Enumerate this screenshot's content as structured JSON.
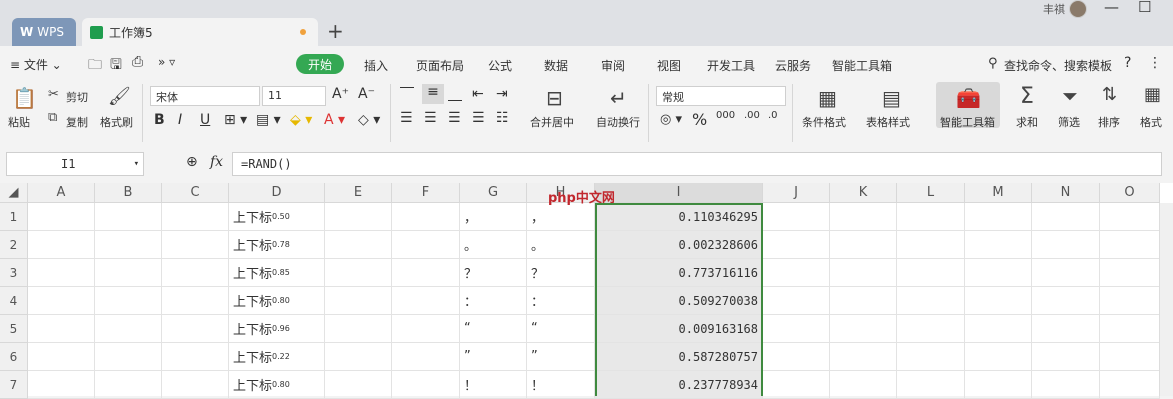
{
  "tabs": {
    "wps": "WPS",
    "workbook": "工作簿5",
    "add": "+"
  },
  "user": {
    "name": "丰祺"
  },
  "window": {
    "minimize": "—",
    "maximize": "☐"
  },
  "menu": {
    "file": "≡ 文件 ⌄",
    "items": [
      "开始",
      "插入",
      "页面布局",
      "公式",
      "数据",
      "审阅",
      "视图",
      "开发工具",
      "云服务",
      "智能工具箱"
    ],
    "search": "查找命令、搜索模板",
    "help": "?",
    "more": "⋮"
  },
  "ribbon": {
    "paste": "粘贴",
    "cut": "剪切",
    "copy": "复制",
    "format_painter": "格式刷",
    "font_name": "宋体",
    "font_size": "11",
    "merge_center": "合并居中",
    "wrap_text": "自动换行",
    "number_format": "常规",
    "conditional_format": "条件格式",
    "table_style": "表格样式",
    "smart_toolbox": "智能工具箱",
    "sum": "求和",
    "filter": "筛选",
    "sort": "排序",
    "format": "格式"
  },
  "formula": {
    "cell_ref": "I1",
    "fx": "fx",
    "content": "=RAND()"
  },
  "columns": [
    "A",
    "B",
    "C",
    "D",
    "E",
    "F",
    "G",
    "H",
    "I",
    "J",
    "K",
    "L",
    "M",
    "N",
    "O"
  ],
  "rows": [
    {
      "n": "1",
      "d_base": "上下标",
      "d_sup": "0.50",
      "g": "，",
      "h": "，",
      "i": "0.110346295"
    },
    {
      "n": "2",
      "d_base": "上下标",
      "d_sup": "0.78",
      "g": "。",
      "h": "。",
      "i": "0.002328606"
    },
    {
      "n": "3",
      "d_base": "上下标",
      "d_sup": "0.85",
      "g": "？",
      "h": "？",
      "i": "0.773716116"
    },
    {
      "n": "4",
      "d_base": "上下标",
      "d_sup": "0.80",
      "g": "：",
      "h": "：",
      "i": "0.509270038"
    },
    {
      "n": "5",
      "d_base": "上下标",
      "d_sup": "0.96",
      "g": "“",
      "h": "“",
      "i": "0.009163168"
    },
    {
      "n": "6",
      "d_base": "上下标",
      "d_sup": "0.22",
      "g": "”",
      "h": "”",
      "i": "0.587280757"
    },
    {
      "n": "7",
      "d_base": "上下标",
      "d_sup": "0.80",
      "g": "！",
      "h": "！",
      "i": "0.237778934"
    }
  ],
  "watermark": "php中文网",
  "colors": {
    "accent": "#34a853",
    "selection": "#3f8a3f",
    "wps_tab": "#7e97b8"
  }
}
